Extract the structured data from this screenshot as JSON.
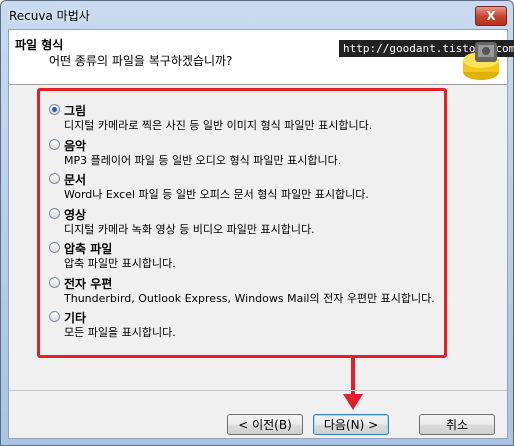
{
  "window": {
    "title": "Recuva 마법사",
    "close_label": "X"
  },
  "header": {
    "title": "파일 형식",
    "subtitle": "어떤 종류의 파일을 복구하겠습니까?",
    "watermark": "http://goodant.tistory.com"
  },
  "options": [
    {
      "label": "그림",
      "desc": "디지털 카메라로 찍은 사진 등 일반 이미지 형식 파일만 표시합니다.",
      "selected": true
    },
    {
      "label": "음악",
      "desc": "MP3 플레이어 파일 등 일반 오디오 형식 파일만 표시합니다.",
      "selected": false
    },
    {
      "label": "문서",
      "desc": "Word나 Excel 파일 등 일반 오피스 문서 형식 파일만 표시합니다.",
      "selected": false
    },
    {
      "label": "영상",
      "desc": "디지털 카메라 녹화 영상 등 비디오 파일만 표시합니다.",
      "selected": false
    },
    {
      "label": "압축 파일",
      "desc": "압축 파일만 표시합니다.",
      "selected": false
    },
    {
      "label": "전자 우편",
      "desc": "Thunderbird, Outlook Express, Windows Mail의 전자 우편만 표시합니다.",
      "selected": false
    },
    {
      "label": "기타",
      "desc": "모든 파일을 표시합니다.",
      "selected": false
    }
  ],
  "buttons": {
    "back": "< 이전(B)",
    "next": "다음(N) >",
    "cancel": "취소"
  },
  "colors": {
    "highlight": "#e32028",
    "radio_dot": "#2b5ea8"
  }
}
